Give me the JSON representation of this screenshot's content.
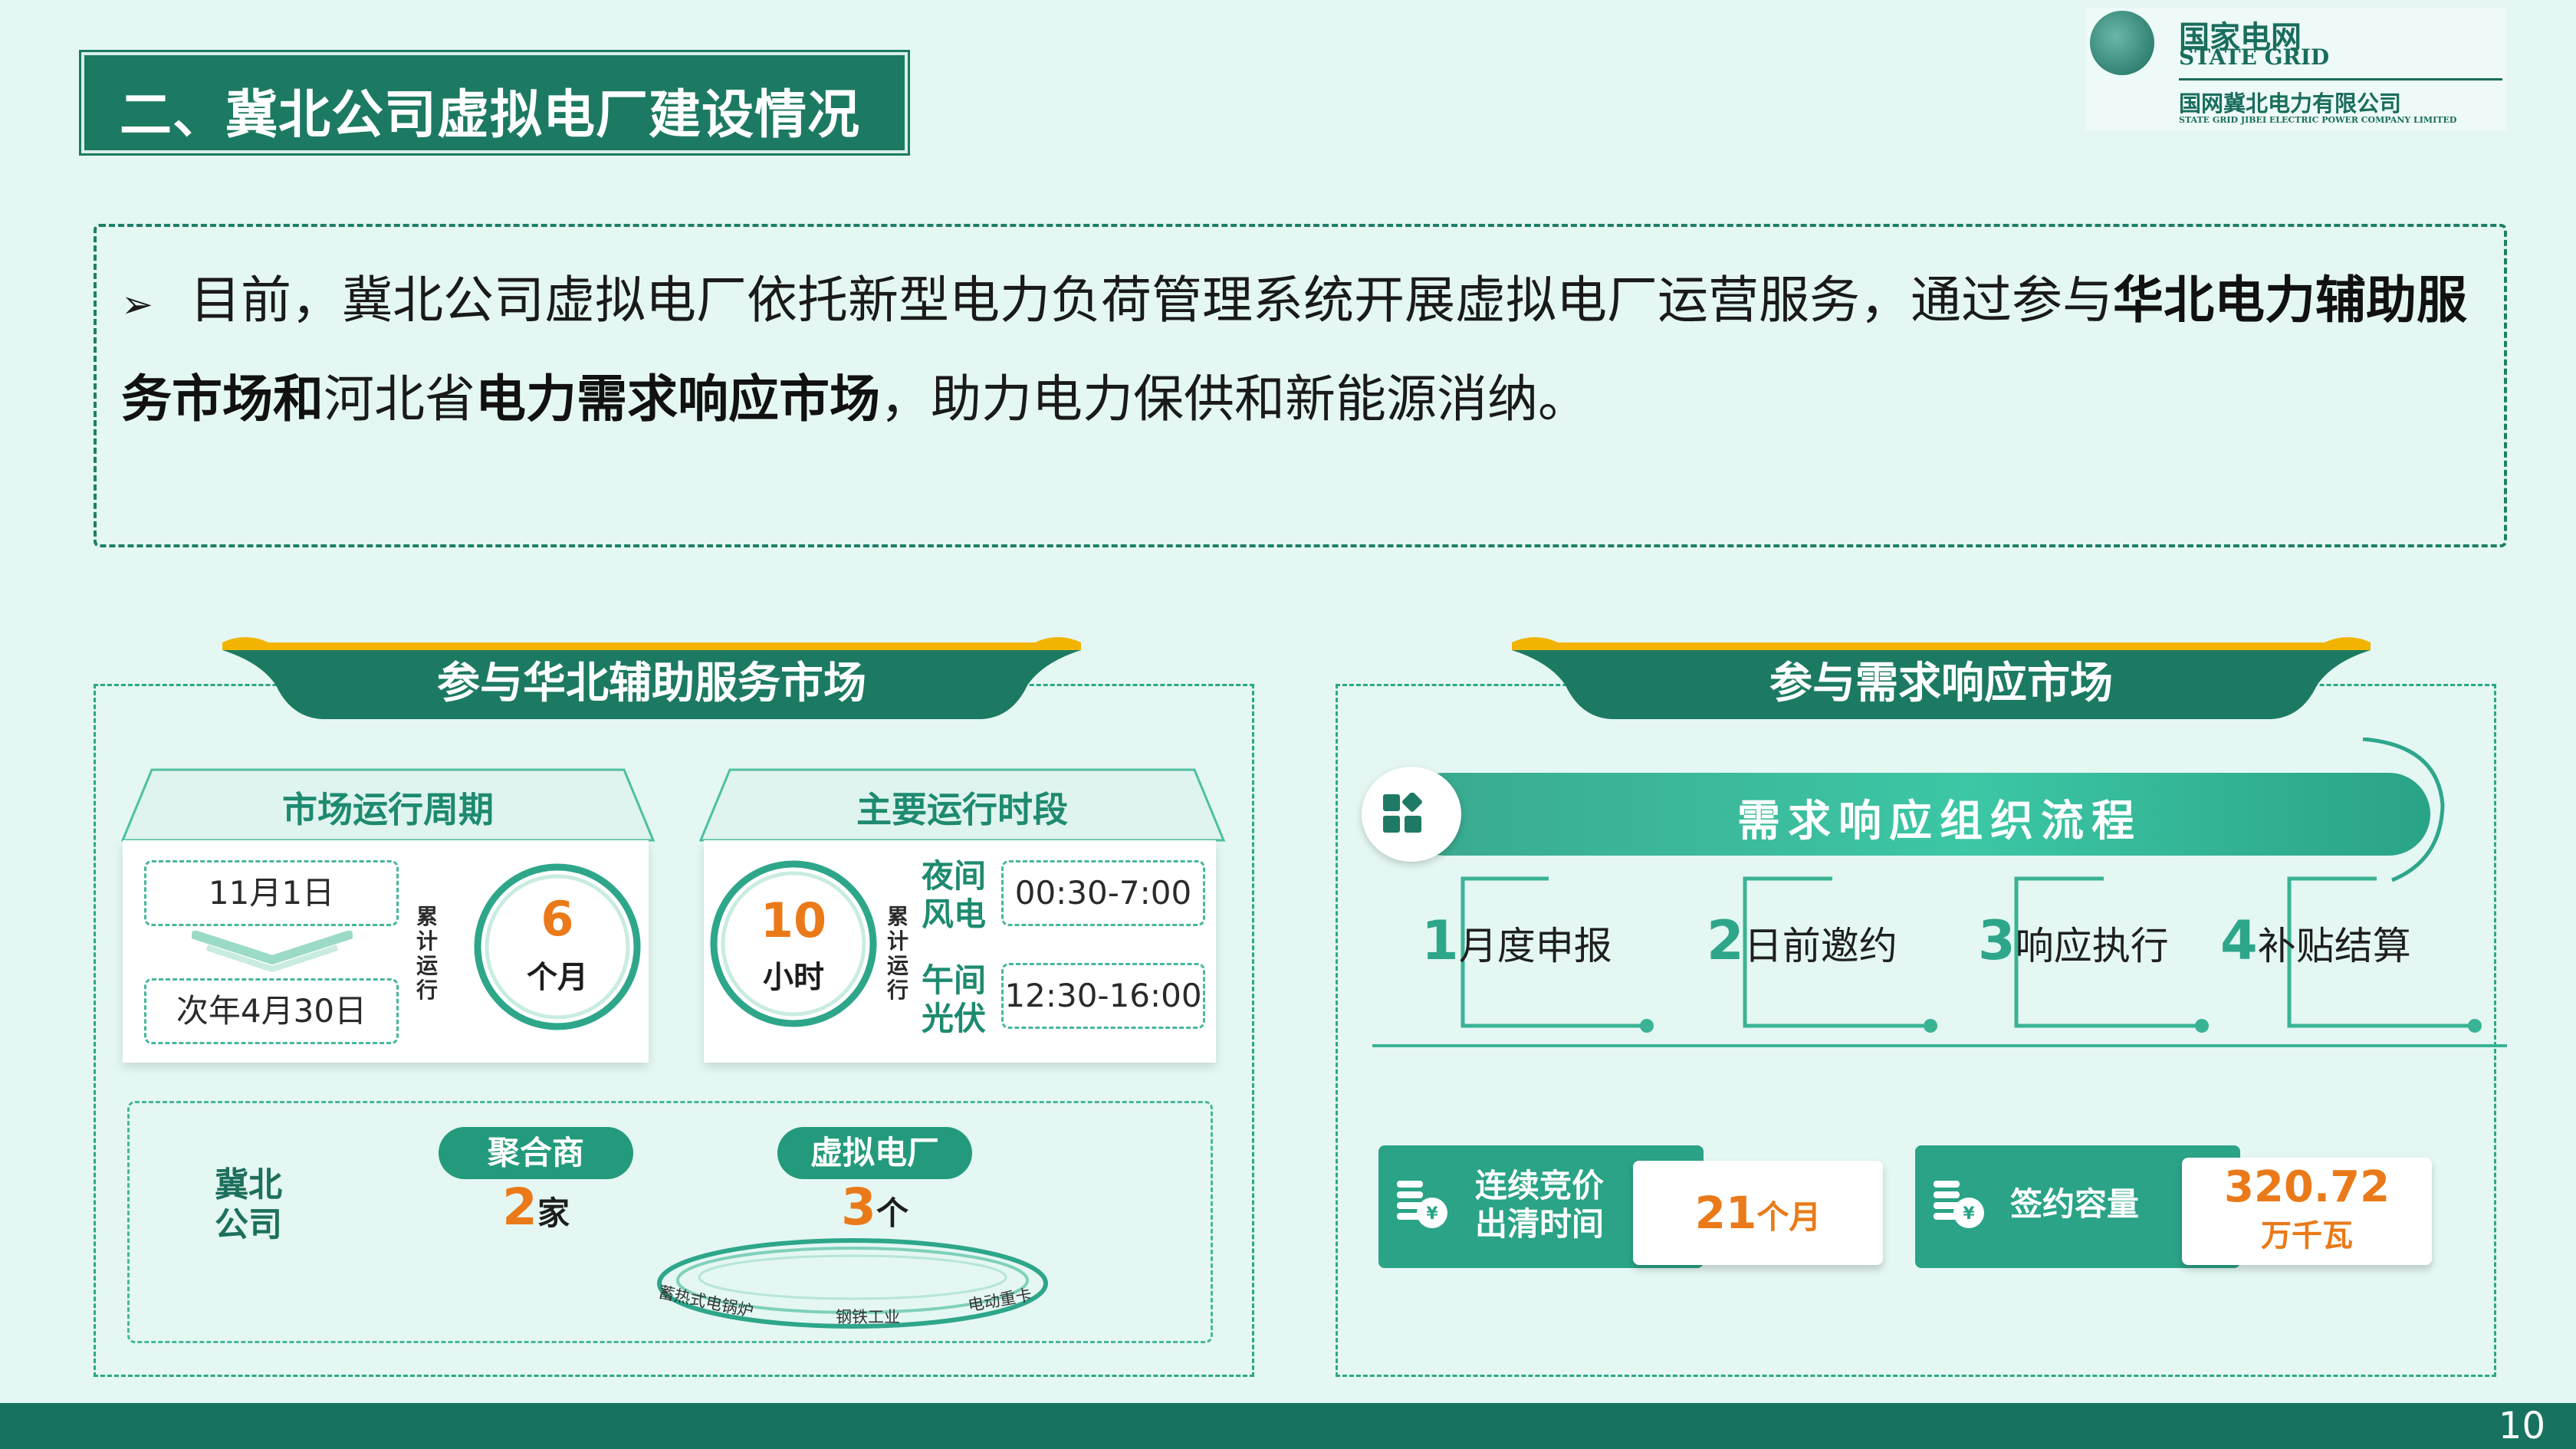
{
  "title": "二、冀北公司虚拟电厂建设情况",
  "logo": {
    "cn": "国家电网",
    "en": "STATE GRID",
    "company": "国网冀北电力有限公司",
    "company_en": "STATE GRID JIBEI ELECTRIC POWER COMPANY LIMITED"
  },
  "intro": {
    "part1": "目前，冀北公司虚拟电厂依托新型电力负荷管理系统开展虚拟电厂运营服务，通过参与",
    "bold1": "华北电力辅助服务市场和",
    "part2": "河北省",
    "bold2": "电力需求响应市场",
    "part3": "，助力电力保供和新能源消纳。"
  },
  "left_panel": {
    "banner": "参与华北辅助服务市场",
    "cycle": {
      "header": "市场运行周期",
      "start": "11月1日",
      "end": "次年4月30日",
      "vertical": "累计运行",
      "value": "6",
      "unit": "个月"
    },
    "period": {
      "header": "主要运行时段",
      "value": "10",
      "unit": "小时",
      "vertical": "累计运行",
      "night_label": "夜间风电",
      "night_time": "00:30-7:00",
      "noon_label": "午间光伏",
      "noon_time": "12:30-16:00"
    },
    "company": {
      "label": "冀北公司",
      "aggregator_pill": "聚合商",
      "aggregator_num": "2",
      "aggregator_unit": "家",
      "vpp_pill": "虚拟电厂",
      "vpp_num": "3",
      "vpp_unit": "个",
      "ring_labels": [
        "蓄热式电锅炉",
        "钢铁工业",
        "电动重卡"
      ]
    }
  },
  "right_panel": {
    "banner": "参与需求响应市场",
    "process_title": "需求响应组织流程",
    "steps": [
      {
        "num": "1",
        "label": "月度申报"
      },
      {
        "num": "2",
        "label": "日前邀约"
      },
      {
        "num": "3",
        "label": "响应执行"
      },
      {
        "num": "4",
        "label": "补贴结算"
      }
    ],
    "stat1": {
      "label_line1": "连续竞价",
      "label_line2": "出清时间",
      "value": "21",
      "unit": "个月"
    },
    "stat2": {
      "label": "签约容量",
      "value": "320.72",
      "unit": "万千瓦"
    }
  },
  "page_number": "10",
  "colors": {
    "background": "#e4f7f3",
    "primary": "#1c7a62",
    "accent_teal": "#2aa386",
    "accent_orange": "#ea7a19",
    "accent_yellow": "#f2b400"
  }
}
